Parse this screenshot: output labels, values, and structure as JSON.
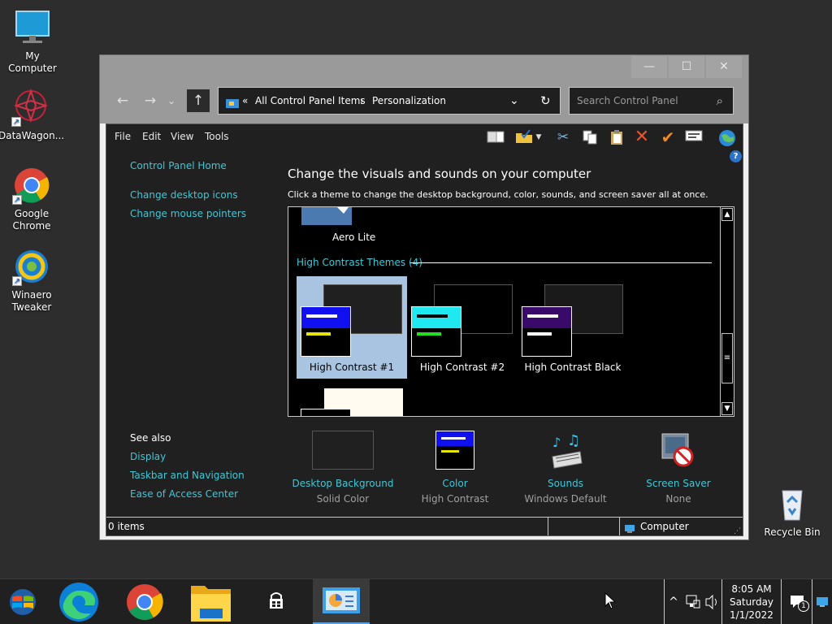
{
  "desktop": {
    "icons": [
      {
        "label": "My Computer",
        "icon": "monitor-icon"
      },
      {
        "label": "DataWagon...",
        "icon": "datawagon-icon"
      },
      {
        "label": "Google Chrome",
        "icon": "chrome-icon"
      },
      {
        "label": "Winaero Tweaker",
        "icon": "winaero-icon"
      },
      {
        "label": "Recycle Bin",
        "icon": "recycle-bin-icon"
      }
    ]
  },
  "window": {
    "controls": {
      "minimize": "—",
      "maximize": "☐",
      "close": "✕"
    },
    "nav": {
      "back": "←",
      "forward": "→",
      "recent": "⌄",
      "up": "↑"
    },
    "address": {
      "sep_start": "«",
      "crumb1": "All Control Panel Items",
      "sep": "›",
      "crumb2": "Personalization",
      "dropdown": "⌄",
      "refresh": "↻"
    },
    "search": {
      "placeholder": "Search Control Panel",
      "icon": "⌕"
    },
    "menu": [
      "File",
      "Edit",
      "View",
      "Tools"
    ],
    "help": "?",
    "sidebar": {
      "home": "Control Panel Home",
      "links": [
        "Change desktop icons",
        "Change mouse pointers"
      ],
      "see_also_title": "See also",
      "see_also": [
        "Display",
        "Taskbar and Navigation",
        "Ease of Access Center"
      ]
    },
    "main": {
      "title": "Change the visuals and sounds on your computer",
      "subtitle": "Click a theme to change the desktop background, color, sounds, and screen saver all at once.",
      "aero_lite": "Aero Lite",
      "section": "High Contrast Themes (4)",
      "themes": [
        {
          "label": "High Contrast #1",
          "selected": true
        },
        {
          "label": "High Contrast #2",
          "selected": false
        },
        {
          "label": "High Contrast Black",
          "selected": false
        }
      ],
      "scroll": {
        "up": "▲",
        "down": "▼",
        "grip": "≡"
      }
    },
    "bottom": [
      {
        "label": "Desktop Background",
        "value": "Solid Color"
      },
      {
        "label": "Color",
        "value": "High Contrast"
      },
      {
        "label": "Sounds",
        "value": "Windows Default"
      },
      {
        "label": "Screen Saver",
        "value": "None"
      }
    ],
    "status": {
      "items": "0 items",
      "location": "Computer"
    }
  },
  "taskbar": {
    "tray_chevron": "^",
    "time": "8:05 AM",
    "day": "Saturday",
    "date": "1/1/2022",
    "notification_count": "1"
  },
  "colors": {
    "link": "#3ec8d8",
    "selected": "#a8c4e0",
    "window_chrome": "#9a9a9a"
  }
}
